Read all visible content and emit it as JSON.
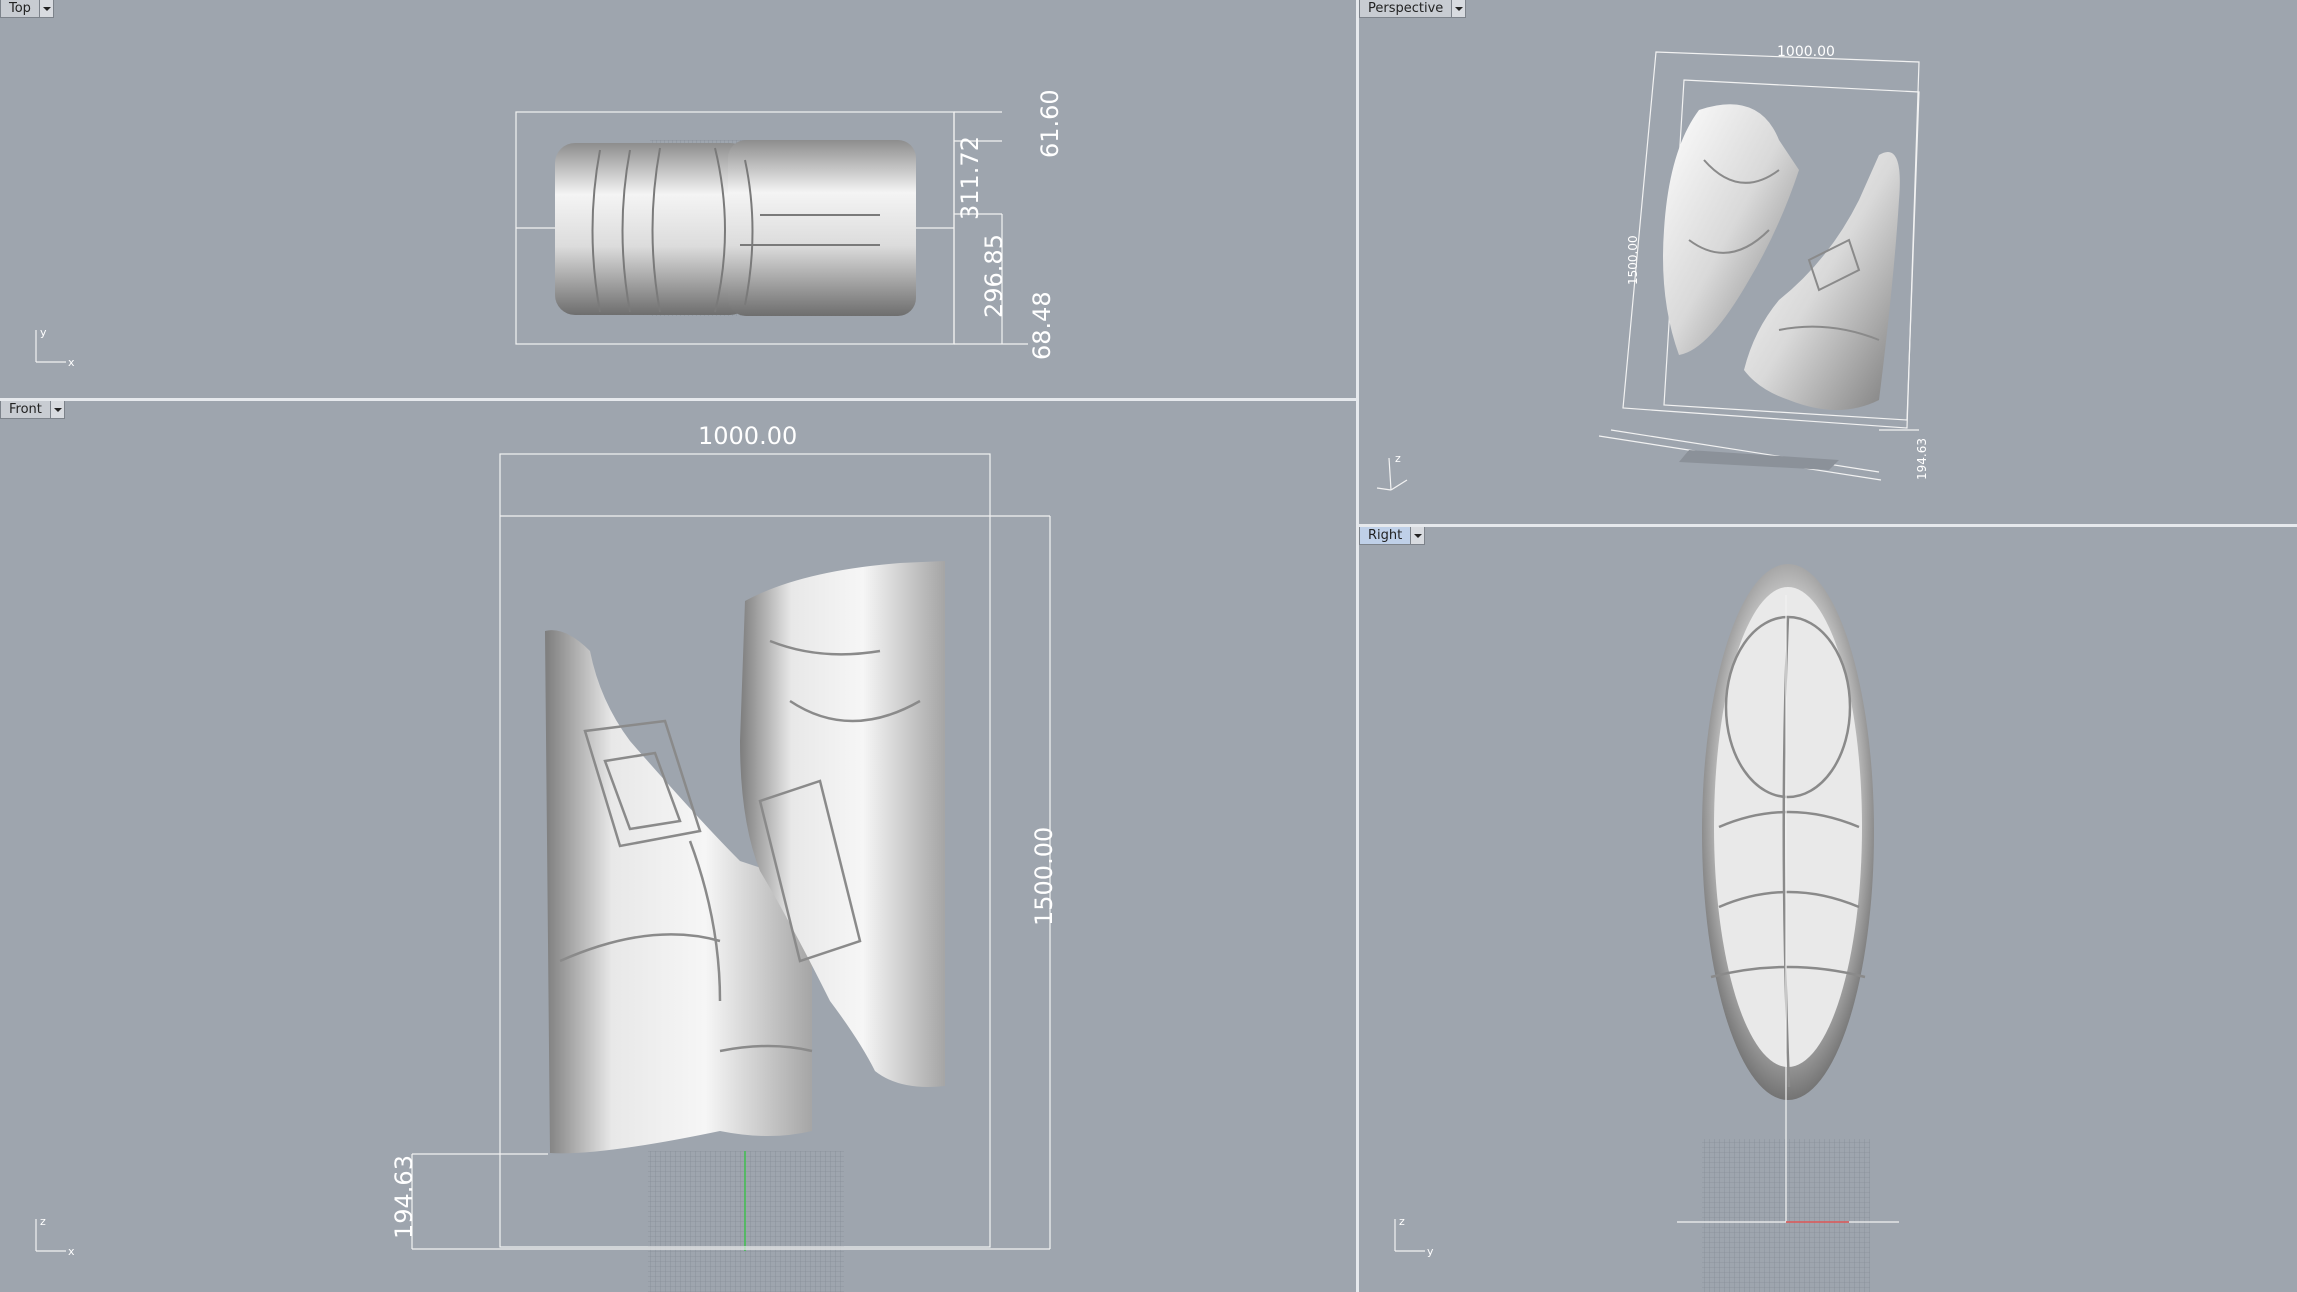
{
  "viewports": {
    "top": {
      "label": "Top",
      "axis_a": "y",
      "axis_b": "x",
      "dims": {
        "d1": "61.60",
        "d2": "311.72",
        "d3": "296.85",
        "d4": "68.48"
      }
    },
    "perspective": {
      "label": "Perspective",
      "axis_a": "z",
      "dims": {
        "width": "1000.00",
        "height": "1500.00",
        "depth": "194.63"
      }
    },
    "front": {
      "label": "Front",
      "axis_a": "z",
      "axis_b": "x",
      "dims": {
        "width": "1000.00",
        "height": "1500.00",
        "depth": "194.63"
      }
    },
    "right": {
      "label": "Right",
      "axis_a": "z",
      "axis_b": "y"
    }
  },
  "colors": {
    "viewport_bg": "#9ea5ae",
    "separator": "#e6e9ed",
    "model": "#f2f2f2"
  }
}
